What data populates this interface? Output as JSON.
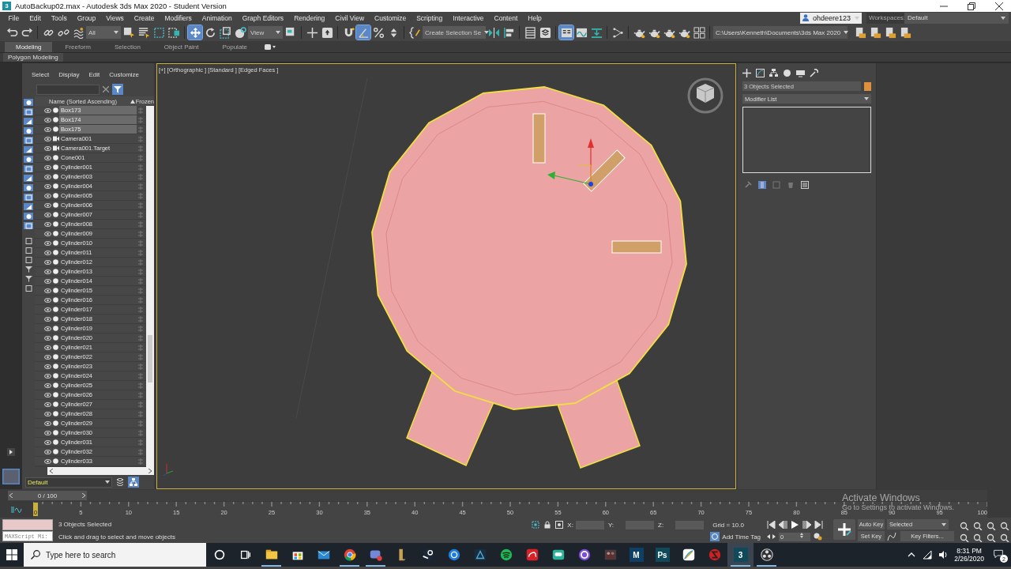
{
  "window": {
    "app_glyph": "3",
    "title": "AutoBackup02.max - Autodesk 3ds Max 2020 - Student Version"
  },
  "menu_bar": {
    "items": [
      "File",
      "Edit",
      "Tools",
      "Group",
      "Views",
      "Create",
      "Modifiers",
      "Animation",
      "Graph Editors",
      "Rendering",
      "Civil View",
      "Customize",
      "Scripting",
      "Interactive",
      "Content",
      "Help"
    ],
    "user": "ohdeere123",
    "workspaces_label": "Workspaces:",
    "workspace": "Default"
  },
  "main_toolbar": {
    "items": [
      {
        "kind": "undo",
        "selected": false
      },
      {
        "kind": "redo",
        "selected": false
      },
      {
        "kind": "sep"
      },
      {
        "kind": "link",
        "selected": false
      },
      {
        "kind": "unlink",
        "selected": false
      },
      {
        "kind": "bind",
        "selected": false
      },
      {
        "kind": "dropdown",
        "value": "All"
      },
      {
        "kind": "select",
        "selected": false
      },
      {
        "kind": "select-by-name",
        "selected": false
      },
      {
        "kind": "region",
        "selected": false
      },
      {
        "kind": "crossing",
        "selected": false
      },
      {
        "kind": "sep"
      },
      {
        "kind": "move",
        "selected": true
      },
      {
        "kind": "rotate",
        "selected": false
      },
      {
        "kind": "scale",
        "selected": false
      },
      {
        "kind": "manipulate",
        "selected": false
      },
      {
        "kind": "dropdown",
        "value": "View"
      },
      {
        "kind": "pivot",
        "selected": false
      },
      {
        "kind": "sep"
      },
      {
        "kind": "crosshair",
        "selected": false
      },
      {
        "kind": "place",
        "selected": false
      },
      {
        "kind": "sep"
      },
      {
        "kind": "snap",
        "selected": false
      },
      {
        "kind": "angle",
        "selected": true
      },
      {
        "kind": "percent",
        "selected": false
      },
      {
        "kind": "spinner",
        "selected": false
      },
      {
        "kind": "sep"
      },
      {
        "kind": "brace",
        "selected": false
      },
      {
        "kind": "dropdown",
        "value": "Create Selection Se"
      },
      {
        "kind": "mirror",
        "selected": false
      },
      {
        "kind": "align",
        "selected": false
      },
      {
        "kind": "sep"
      },
      {
        "kind": "table",
        "selected": false
      },
      {
        "kind": "layers",
        "selected": false
      },
      {
        "kind": "sep"
      },
      {
        "kind": "ribbon",
        "selected": true
      },
      {
        "kind": "curve",
        "selected": false
      },
      {
        "kind": "download",
        "selected": false
      },
      {
        "kind": "sep"
      },
      {
        "kind": "nodes",
        "selected": false
      },
      {
        "kind": "sep"
      },
      {
        "kind": "teapot",
        "selected": false
      },
      {
        "kind": "teapot",
        "selected": false
      },
      {
        "kind": "teapot",
        "selected": false
      },
      {
        "kind": "teapot",
        "selected": false
      },
      {
        "kind": "grid",
        "selected": false
      },
      {
        "kind": "sep"
      },
      {
        "kind": "path",
        "value": "C:\\Users\\Kenneth\\Documents\\3ds Max 2020"
      },
      {
        "kind": "folder",
        "selected": false
      },
      {
        "kind": "folder",
        "selected": false
      },
      {
        "kind": "folder",
        "selected": false
      },
      {
        "kind": "folder",
        "selected": false
      }
    ]
  },
  "ribbon": {
    "tabs": [
      {
        "label": "Modeling",
        "selected": true
      },
      {
        "label": "Freeform",
        "selected": false
      },
      {
        "label": "Selection",
        "selected": false
      },
      {
        "label": "Object Paint",
        "selected": false
      },
      {
        "label": "Populate",
        "selected": false
      }
    ],
    "panel": "Polygon Modeling"
  },
  "scene_explorer": {
    "menus": [
      "Select",
      "Display",
      "Edit",
      "Customize"
    ],
    "columns": [
      "Name (Sorted Ascending)",
      "Frozen"
    ],
    "rows": [
      {
        "name": "Box173",
        "kind": "geometry",
        "selected": true
      },
      {
        "name": "Box174",
        "kind": "geometry",
        "selected": true
      },
      {
        "name": "Box175",
        "kind": "geometry",
        "selected": true
      },
      {
        "name": "Camera001",
        "kind": "camera",
        "selected": false
      },
      {
        "name": "Camera001.Target",
        "kind": "camera",
        "selected": false
      },
      {
        "name": "Cone001",
        "kind": "geometry",
        "selected": false
      },
      {
        "name": "Cylinder001",
        "kind": "geometry",
        "selected": false
      },
      {
        "name": "Cylinder003",
        "kind": "geometry",
        "selected": false
      },
      {
        "name": "Cylinder004",
        "kind": "geometry",
        "selected": false
      },
      {
        "name": "Cylinder005",
        "kind": "geometry",
        "selected": false
      },
      {
        "name": "Cylinder006",
        "kind": "geometry",
        "selected": false
      },
      {
        "name": "Cylinder007",
        "kind": "geometry",
        "selected": false
      },
      {
        "name": "Cylinder008",
        "kind": "geometry",
        "selected": false
      },
      {
        "name": "Cylinder009",
        "kind": "geometry",
        "selected": false
      },
      {
        "name": "Cylinder010",
        "kind": "geometry",
        "selected": false
      },
      {
        "name": "Cylinder011",
        "kind": "geometry",
        "selected": false
      },
      {
        "name": "Cylinder012",
        "kind": "geometry",
        "selected": false
      },
      {
        "name": "Cylinder013",
        "kind": "geometry",
        "selected": false
      },
      {
        "name": "Cylinder014",
        "kind": "geometry",
        "selected": false
      },
      {
        "name": "Cylinder015",
        "kind": "geometry",
        "selected": false
      },
      {
        "name": "Cylinder016",
        "kind": "geometry",
        "selected": false
      },
      {
        "name": "Cylinder017",
        "kind": "geometry",
        "selected": false
      },
      {
        "name": "Cylinder018",
        "kind": "geometry",
        "selected": false
      },
      {
        "name": "Cylinder019",
        "kind": "geometry",
        "selected": false
      },
      {
        "name": "Cylinder020",
        "kind": "geometry",
        "selected": false
      },
      {
        "name": "Cylinder021",
        "kind": "geometry",
        "selected": false
      },
      {
        "name": "Cylinder022",
        "kind": "geometry",
        "selected": false
      },
      {
        "name": "Cylinder023",
        "kind": "geometry",
        "selected": false
      },
      {
        "name": "Cylinder024",
        "kind": "geometry",
        "selected": false
      },
      {
        "name": "Cylinder025",
        "kind": "geometry",
        "selected": false
      },
      {
        "name": "Cylinder026",
        "kind": "geometry",
        "selected": false
      },
      {
        "name": "Cylinder027",
        "kind": "geometry",
        "selected": false
      },
      {
        "name": "Cylinder028",
        "kind": "geometry",
        "selected": false
      },
      {
        "name": "Cylinder029",
        "kind": "geometry",
        "selected": false
      },
      {
        "name": "Cylinder030",
        "kind": "geometry",
        "selected": false
      },
      {
        "name": "Cylinder031",
        "kind": "geometry",
        "selected": false
      },
      {
        "name": "Cylinder032",
        "kind": "geometry",
        "selected": false
      },
      {
        "name": "Cylinder033",
        "kind": "geometry",
        "selected": false
      }
    ],
    "layer": "Default"
  },
  "viewport": {
    "labels": [
      "[+]",
      "[Orthographic ]",
      "[Standard ]",
      "[Edged Faces ]"
    ]
  },
  "command_panel": {
    "selection_name": "3 Objects Selected",
    "modifier_list": "Modifier List"
  },
  "time_slider": {
    "position": "0 / 100",
    "ticks": [
      "0",
      "5",
      "10",
      "15",
      "20",
      "25",
      "30",
      "35",
      "40",
      "45",
      "50",
      "55",
      "60",
      "65",
      "70",
      "75",
      "80",
      "85",
      "90",
      "95",
      "100"
    ]
  },
  "status_bar": {
    "listener": "MAXScript Mi:",
    "selection": "3 Objects Selected",
    "prompt": "Click and drag to select and move objects",
    "axes": [
      "X:",
      "Y:",
      "Z:"
    ],
    "grid": "Grid = 10.0",
    "time_tag": "Add Time Tag",
    "frame": "0",
    "auto_key": "Auto Key",
    "key_mode": "Selected",
    "set_key": "Set Key",
    "key_filters": "Key Filters..."
  },
  "activation": {
    "title": "Activate Windows",
    "message": "Go to Settings to activate Windows."
  },
  "taskbar": {
    "search_placeholder": "Type here to search",
    "apps": [
      {
        "kind": "folder",
        "open": true,
        "selected": false
      },
      {
        "kind": "bag",
        "open": false,
        "selected": false
      },
      {
        "kind": "mail",
        "open": false,
        "selected": false
      },
      {
        "kind": "browser",
        "open": true,
        "selected": false
      },
      {
        "kind": "chat",
        "open": true,
        "selected": false
      },
      {
        "kind": "pillar",
        "open": false,
        "selected": false
      },
      {
        "kind": "steam",
        "open": false,
        "selected": false
      },
      {
        "kind": "spiral",
        "open": false,
        "selected": false
      },
      {
        "kind": "tile",
        "open": false,
        "selected": false
      },
      {
        "kind": "music",
        "open": false,
        "selected": false
      },
      {
        "kind": "cloud",
        "open": false,
        "selected": false
      },
      {
        "kind": "bubble",
        "open": false,
        "selected": false
      },
      {
        "kind": "ring",
        "open": false,
        "selected": false
      },
      {
        "kind": "photo",
        "open": false,
        "selected": false
      },
      {
        "kind": "letter",
        "glyph": "M",
        "open": false,
        "selected": false
      },
      {
        "kind": "letter",
        "glyph": "Ps",
        "open": false,
        "selected": false
      },
      {
        "kind": "pen",
        "open": false,
        "selected": false
      },
      {
        "kind": "snake",
        "open": false,
        "selected": false
      },
      {
        "kind": "letter",
        "glyph": "3",
        "open": true,
        "selected": true
      },
      {
        "kind": "aperture",
        "open": true,
        "selected": false
      }
    ],
    "time": "8:31 PM",
    "date": "2/26/2020",
    "notifications": "2"
  }
}
